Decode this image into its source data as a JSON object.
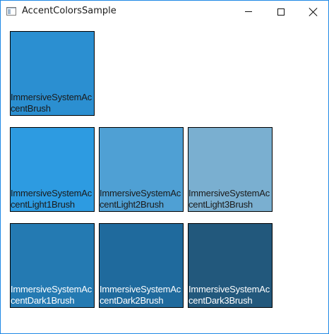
{
  "window": {
    "title": "AccentColorsSample",
    "icon": "app-window-icon",
    "frame_color": "#1e88e5"
  },
  "caption_buttons": {
    "minimize_icon": "minimize-icon",
    "maximize_icon": "maximize-icon",
    "close_icon": "close-icon"
  },
  "swatches": {
    "accent": {
      "label": "ImmersiveSystemAccentBrush",
      "color": "#2b8fd1"
    },
    "light1": {
      "label": "ImmersiveSystemAccentLight1Brush",
      "color": "#2d9be1"
    },
    "light2": {
      "label": "ImmersiveSystemAccentLight2Brush",
      "color": "#4fa0d4"
    },
    "light3": {
      "label": "ImmersiveSystemAccentLight3Brush",
      "color": "#7aafd0"
    },
    "dark1": {
      "label": "ImmersiveSystemAccentDark1Brush",
      "color": "#247ab2"
    },
    "dark2": {
      "label": "ImmersiveSystemAccentDark2Brush",
      "color": "#1f6a9d"
    },
    "dark3": {
      "label": "ImmersiveSystemAccentDark3Brush",
      "color": "#22587c"
    }
  }
}
